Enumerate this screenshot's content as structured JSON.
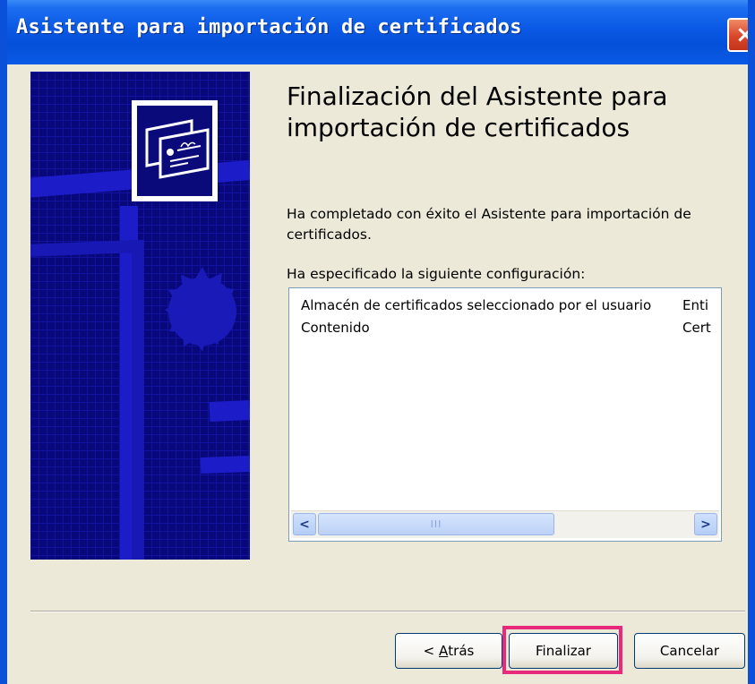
{
  "window": {
    "title": "Asistente para importación de certificados",
    "close_glyph": "×"
  },
  "content": {
    "heading": "Finalización del Asistente para importación de certificados",
    "description": "Ha completado con éxito el Asistente para importación de certificados.",
    "config_label": "Ha especificado la siguiente configuración:"
  },
  "config_list": {
    "rows": [
      {
        "setting": "Almacén de certificados seleccionado por el usuario",
        "value": "Enti"
      },
      {
        "setting": "Contenido",
        "value": "Cert"
      }
    ],
    "scroll_left_glyph": "<",
    "scroll_right_glyph": ">",
    "thumb_grip": "III"
  },
  "buttons": {
    "back_prefix": "< ",
    "back_mnemonic": "A",
    "back_rest": "trás",
    "finish": "Finalizar",
    "cancel": "Cancelar"
  },
  "icons": {
    "banner": "certificate-wizard-icon",
    "close": "close-icon"
  },
  "colors": {
    "titlebar": "#0550d8",
    "banner_bg": "#0a0a7a",
    "highlight": "#e82a7c",
    "window_bg": "#ece9d8"
  }
}
